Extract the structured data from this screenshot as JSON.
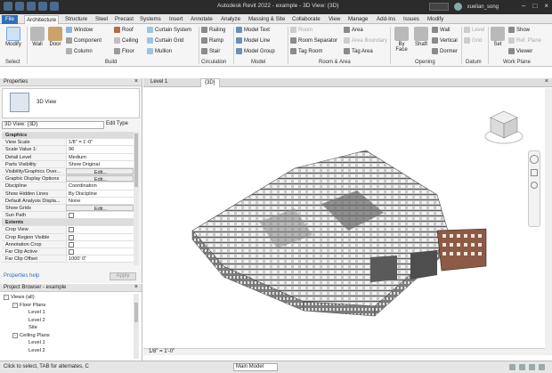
{
  "app": {
    "title": "Autodesk Revit 2022 - example - 3D View: {3D}",
    "user": "xuelian_song"
  },
  "tabs": [
    "File",
    "Architecture",
    "Structure",
    "Steel",
    "Precast",
    "Systems",
    "Insert",
    "Annotate",
    "Analyze",
    "Massing & Site",
    "Collaborate",
    "View",
    "Manage",
    "Add-Ins",
    "Issues",
    "Modify"
  ],
  "ribbon": {
    "select": {
      "modify": "Modify",
      "panel": "Select"
    },
    "build": {
      "wall": "Wall",
      "door": "Door",
      "window": "Window",
      "component": "Component",
      "column": "Column",
      "roof": "Roof",
      "ceiling": "Ceiling",
      "floor": "Floor",
      "curtain_system": "Curtain System",
      "curtain_grid": "Curtain Grid",
      "mullion": "Mullion",
      "panel": "Build"
    },
    "circulation": {
      "railing": "Railing",
      "ramp": "Ramp",
      "stair": "Stair",
      "panel": "Circulation"
    },
    "model": {
      "model_text": "Model Text",
      "model_line": "Model Line",
      "model_group": "Model Group",
      "panel": "Model"
    },
    "room_area": {
      "room": "Room",
      "room_separator": "Room Separator",
      "tag_room": "Tag Room",
      "area": "Area",
      "area_boundary": "Area Boundary",
      "tag_area": "Tag Area",
      "panel": "Room & Area"
    },
    "opening": {
      "by_face": "By Face",
      "shaft": "Shaft",
      "wall": "Wall",
      "vertical": "Vertical",
      "dormer": "Dormer",
      "panel": "Opening"
    },
    "datum": {
      "level": "Level",
      "grid": "Grid",
      "panel": "Datum"
    },
    "work_plane": {
      "set": "Set",
      "show": "Show",
      "ref_plane": "Ref. Plane",
      "viewer": "Viewer",
      "panel": "Work Plane"
    }
  },
  "properties": {
    "title": "Properties",
    "type_name": "3D View",
    "instance": "3D View: {3D}",
    "edit_type": "Edit Type",
    "rows": [
      {
        "k": "Graphics",
        "group": true
      },
      {
        "k": "View Scale",
        "v": "1/8\" = 1'-0\""
      },
      {
        "k": "Scale Value    1:",
        "v": "96"
      },
      {
        "k": "Detail Level",
        "v": "Medium"
      },
      {
        "k": "Parts Visibility",
        "v": "Show Original"
      },
      {
        "k": "Visibility/Graphics Over...",
        "v": "Edit...",
        "btn": true
      },
      {
        "k": "Graphic Display Options",
        "v": "Edit...",
        "btn": true
      },
      {
        "k": "Discipline",
        "v": "Coordination"
      },
      {
        "k": "Show Hidden Lines",
        "v": "By Discipline"
      },
      {
        "k": "Default Analysis Displa...",
        "v": "None"
      },
      {
        "k": "Show Grids",
        "v": "Edit...",
        "btn": true
      },
      {
        "k": "Sun Path",
        "v": "",
        "check": true
      },
      {
        "k": "Extents",
        "group": true
      },
      {
        "k": "Crop View",
        "v": "",
        "check": true
      },
      {
        "k": "Crop Region Visible",
        "v": "",
        "check": true
      },
      {
        "k": "Annotation Crop",
        "v": "",
        "check": true
      },
      {
        "k": "Far Clip Active",
        "v": "",
        "check": true
      },
      {
        "k": "Far Clip Offset",
        "v": "1000' 0\""
      }
    ],
    "help": "Properties help",
    "apply": "Apply"
  },
  "browser": {
    "title": "Project Browser - example",
    "nodes": [
      {
        "label": "Views (all)",
        "level": 0,
        "toggle": "-"
      },
      {
        "label": "Floor Plans",
        "level": 1,
        "toggle": "-"
      },
      {
        "label": "Level 1",
        "level": 2
      },
      {
        "label": "Level 2",
        "level": 2
      },
      {
        "label": "Site",
        "level": 2
      },
      {
        "label": "Ceiling Plans",
        "level": 1,
        "toggle": "-"
      },
      {
        "label": "Level 1",
        "level": 2
      },
      {
        "label": "Level 2",
        "level": 2
      }
    ]
  },
  "view_tabs": [
    "Level 1",
    "{3D}"
  ],
  "view_control": {
    "scale": "1/8\" = 1'-0\""
  },
  "status": {
    "message": "Click to select, TAB for alternates, C",
    "workset": "Main Model"
  },
  "colors": {
    "file_tab": "#2e6fbd",
    "titlebar": "#2b2b2b"
  }
}
